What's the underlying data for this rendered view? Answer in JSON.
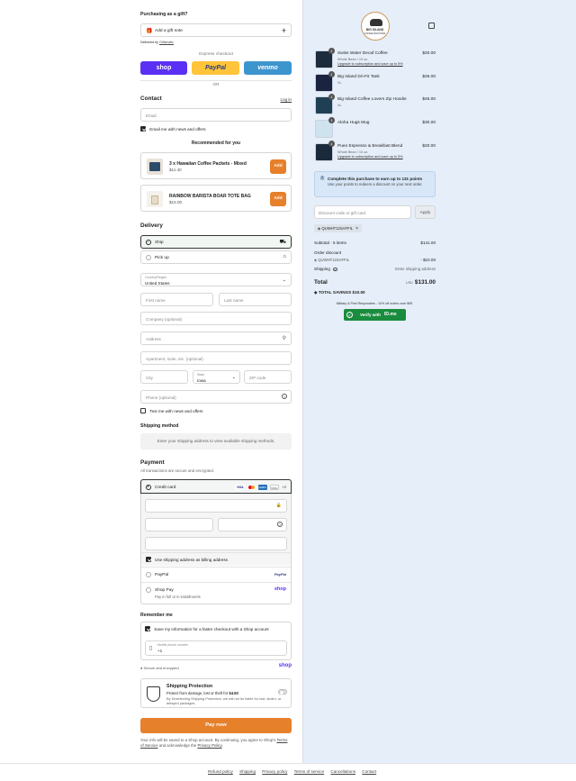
{
  "gift": {
    "heading": "Purchasing as a gift?",
    "add_note": "Add a gift note",
    "delivered_by": "Delivered by",
    "delivered_by_brand": "Giftsmatic"
  },
  "express": {
    "heading": "Express checkout",
    "shop": "shop",
    "paypal": "PayPal",
    "venmo": "venmo",
    "or": "OR"
  },
  "contact": {
    "heading": "Contact",
    "login": "Log in",
    "email_placeholder": "Email",
    "news_label": "Email me with news and offers"
  },
  "recommended": {
    "heading": "Recommended for you",
    "items": [
      {
        "name": "3 x Hawaiian Coffee Packets - Mixed",
        "price": "$11.40",
        "add": "Add"
      },
      {
        "name": "RAINBOW BARISTA BOAR TOTE BAG",
        "price": "$15.00",
        "add": "Add"
      }
    ]
  },
  "delivery": {
    "heading": "Delivery",
    "options": [
      {
        "label": "Ship",
        "selected": true
      },
      {
        "label": "Pick up",
        "selected": false
      }
    ],
    "country_label": "Country/Region",
    "country_value": "United States",
    "first_name": "First name",
    "last_name": "Last name",
    "company": "Company (optional)",
    "address": "Address",
    "apartment": "Apartment, suite, etc. (optional)",
    "city": "City",
    "state_label": "State",
    "state_value": "Iowa",
    "zip": "ZIP code",
    "phone": "Phone (optional)",
    "text_news": "Text me with news and offers"
  },
  "shipping_method": {
    "heading": "Shipping method",
    "placeholder": "Enter your shipping address to view available shipping methods."
  },
  "payment": {
    "heading": "Payment",
    "subtitle": "All transactions are secure and encrypted.",
    "credit_card": "Credit card",
    "more_cards": "+2",
    "billing_same": "Use shipping address as billing address",
    "paypal": "PayPal",
    "shop_pay": "Shop Pay",
    "shop_pay_sub": "Pay in full or in installments",
    "shop_pay_logo": "shop"
  },
  "remember": {
    "heading": "Remember me",
    "save_label": "Save my information for a faster checkout with a Shop account",
    "phone_label": "Mobile phone number",
    "phone_value": "+1",
    "secure": "Secure and encrypted",
    "shop_logo": "shop"
  },
  "protection": {
    "title": "Shipping Protection",
    "line1_prefix": "Protect from damage, lost or theft for ",
    "line1_price": "$4.50",
    "line2": "By Deselecting Shipping Protection, we will not be liable for lost, stolen, or delayed packages."
  },
  "pay_now": "Pay now",
  "terms": {
    "prefix": "Your info will be saved to a Shop account. By continuing, you agree to Shop's ",
    "tos": "Terms of Service",
    "mid": " and acknowledge the ",
    "privacy": "Privacy Policy",
    "suffix": "."
  },
  "footer_links": [
    "Refund policy",
    "Shipping",
    "Privacy policy",
    "Terms of service",
    "Cancellations",
    "Contact"
  ],
  "logo": {
    "line1": "BIG ISLAND",
    "line2": "COFFEE ROASTERS"
  },
  "cart": {
    "items": [
      {
        "qty": "1",
        "name": "Swiss Water Decaf Coffee",
        "variant": "Whole Bean / 10 oz.",
        "upgrade": "Upgrade to subscription and save up to 5%",
        "price": "$20.00",
        "color": "#1d2c3c"
      },
      {
        "qty": "1",
        "name": "Big Island Dri-Fit Tank",
        "variant": "XL",
        "upgrade": "",
        "price": "$26.00",
        "color": "#1a2340"
      },
      {
        "qty": "1",
        "name": "Big Island Coffee Lovers Zip Hoodie",
        "variant": "XL",
        "upgrade": "",
        "price": "$45.00",
        "color": "#1f3f55"
      },
      {
        "qty": "1",
        "name": "Aloha Hugs Mug",
        "variant": "",
        "upgrade": "",
        "price": "$30.00",
        "color": "#cfe3ef"
      },
      {
        "qty": "1",
        "name": "Pueo Espresso & Breakfast Blend",
        "variant": "Whole Bean / 10 oz.",
        "upgrade": "Upgrade to subscription and save up to 5%",
        "price": "$20.00",
        "color": "#1b2a3a"
      }
    ],
    "points_title": "Complete this purchase to earn up to 131 points",
    "points_sub": "Use your points to redeem a discount on your next order.",
    "discount_placeholder": "Discount code or gift card",
    "apply": "Apply",
    "code_tag": "QUWHT12SAFFIL",
    "subtotal_label": "Subtotal · 5 items",
    "subtotal": "$141.00",
    "order_discount": "Order discount",
    "discount_code": "QUWHT12SAFFIL",
    "discount_amount": "- $10.00",
    "shipping_label": "Shipping",
    "shipping_value": "Enter shipping address",
    "total_label": "Total",
    "currency": "USD",
    "total": "$131.00",
    "savings_label": "TOTAL SAVINGS",
    "savings": "$10.00",
    "military": "Military & First Responders - 10% off orders over $95",
    "verify": "Verify with",
    "verify_brand": "ID.me"
  },
  "colors": {
    "accent": "#e6802b",
    "shop": "#5a31f4",
    "paypal": "#ffc439",
    "venmo": "#3d95ce",
    "sidebar": "#e6eef9"
  }
}
